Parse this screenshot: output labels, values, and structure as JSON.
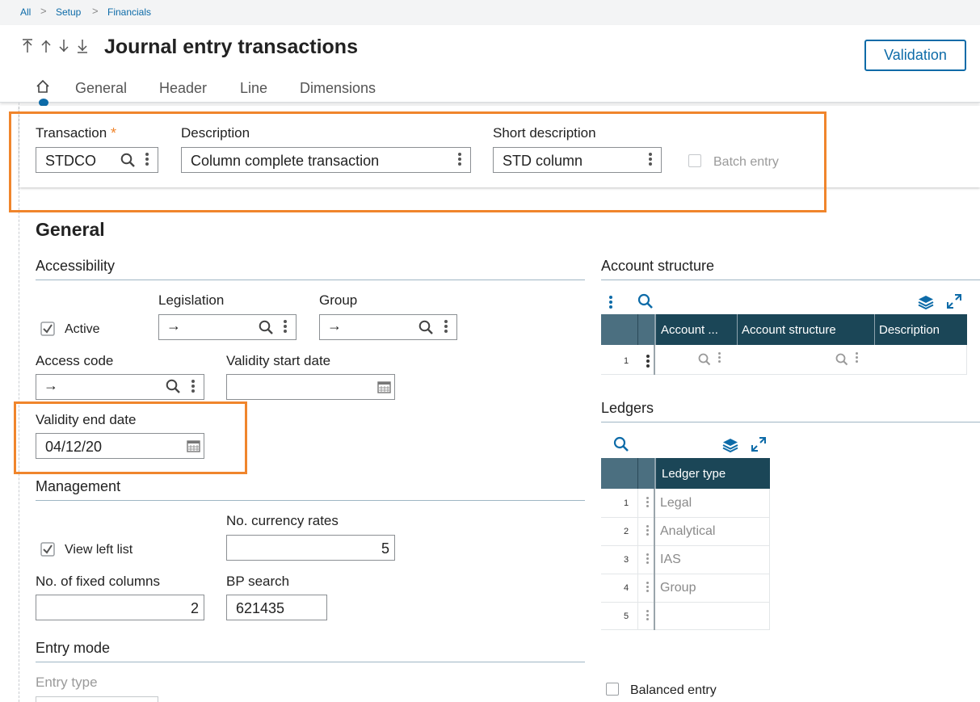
{
  "breadcrumb": [
    "All",
    "Setup",
    "Financials"
  ],
  "page_title": "Journal entry transactions",
  "validation_button": "Validation",
  "tabs": [
    "General",
    "Header",
    "Line",
    "Dimensions"
  ],
  "header_fields": {
    "transaction_label": "Transaction",
    "transaction_required": "*",
    "transaction_value": "STDCO",
    "description_label": "Description",
    "description_value": "Column complete transaction",
    "short_description_label": "Short description",
    "short_description_value": "STD column",
    "batch_entry_label": "Batch entry"
  },
  "general": {
    "title": "General",
    "accessibility": {
      "title": "Accessibility",
      "active_label": "Active",
      "legislation_label": "Legislation",
      "legislation_value": "→",
      "group_label": "Group",
      "group_value": "→",
      "access_code_label": "Access code",
      "access_code_value": "→",
      "validity_start_label": "Validity start date",
      "validity_start_value": "",
      "validity_end_label": "Validity end date",
      "validity_end_value": "04/12/20"
    },
    "management": {
      "title": "Management",
      "view_left_list_label": "View left list",
      "currency_rates_label": "No. currency rates",
      "currency_rates_value": "5",
      "fixed_columns_label": "No. of fixed columns",
      "fixed_columns_value": "2",
      "bp_search_label": "BP search",
      "bp_search_value": "621435"
    },
    "entry_mode": {
      "title": "Entry mode",
      "entry_type_label": "Entry type"
    }
  },
  "account_structure": {
    "title": "Account structure",
    "columns": [
      "Account ...",
      "Account structure",
      "Description"
    ],
    "rows": [
      "1"
    ]
  },
  "ledgers": {
    "title": "Ledgers",
    "column": "Ledger type",
    "rows": [
      {
        "n": "1",
        "value": "Legal"
      },
      {
        "n": "2",
        "value": "Analytical"
      },
      {
        "n": "3",
        "value": "IAS"
      },
      {
        "n": "4",
        "value": "Group"
      },
      {
        "n": "5",
        "value": ""
      }
    ]
  },
  "balanced_entry_label": "Balanced entry",
  "colors": {
    "accent": "#0d6ba8",
    "highlight": "#f0852c",
    "grid_header": "#1b4657"
  }
}
